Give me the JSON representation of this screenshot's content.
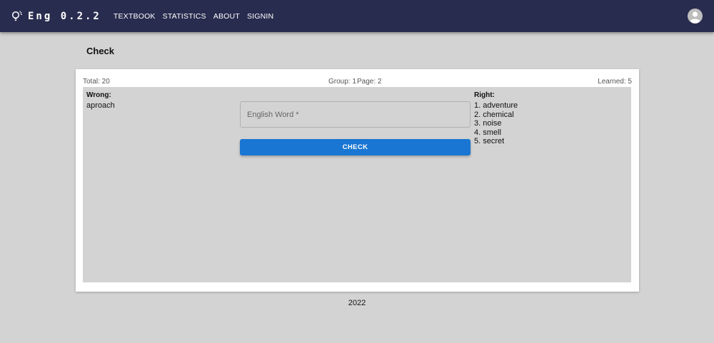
{
  "header": {
    "app_title": "Eng 0.2.2",
    "brand_icon": "lightbulb-icon",
    "nav": [
      {
        "label": "TEXTBOOK"
      },
      {
        "label": "STATISTICS"
      },
      {
        "label": "ABOUT"
      },
      {
        "label": "SIGNIN"
      }
    ],
    "avatar_icon": "user-avatar-icon",
    "background_color": "#282c4f"
  },
  "page": {
    "title": "Check"
  },
  "stats": {
    "total": "Total: 20",
    "group": "Group: 1",
    "page": "Page: 2",
    "learned": "Learned: 5"
  },
  "wrong": {
    "heading": "Wrong:",
    "words": [
      "aproach"
    ]
  },
  "right": {
    "heading": "Right:",
    "words": [
      "1. adventure",
      "2. chemical",
      "3. noise",
      "4. smell",
      "5. secret"
    ]
  },
  "form": {
    "input_placeholder": "English Word *",
    "input_value": "",
    "check_label": "CHECK",
    "button_color": "#1976d2"
  },
  "footer": {
    "text": "2022"
  }
}
